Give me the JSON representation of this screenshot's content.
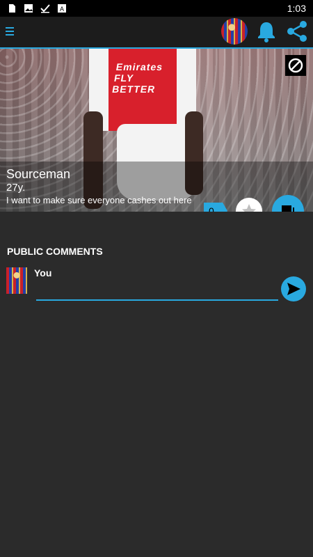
{
  "status_bar": {
    "time": "1:03",
    "icons": [
      "sd-card-icon",
      "image-icon",
      "check-icon",
      "letter-a-icon"
    ]
  },
  "app_bar": {
    "icons": [
      "menu-icon",
      "profile-avatar",
      "bell-icon",
      "share-icon"
    ],
    "accent": "#29a9e0"
  },
  "profile": {
    "name": "Sourceman",
    "age": "27y.",
    "bio": "I want to make sure everyone cashes out here",
    "shirt_text": "Emirates FLY BETTER",
    "counter": "0"
  },
  "comments": {
    "title": "PUBLIC COMMENTS",
    "you_label": "You",
    "input_value": ""
  }
}
